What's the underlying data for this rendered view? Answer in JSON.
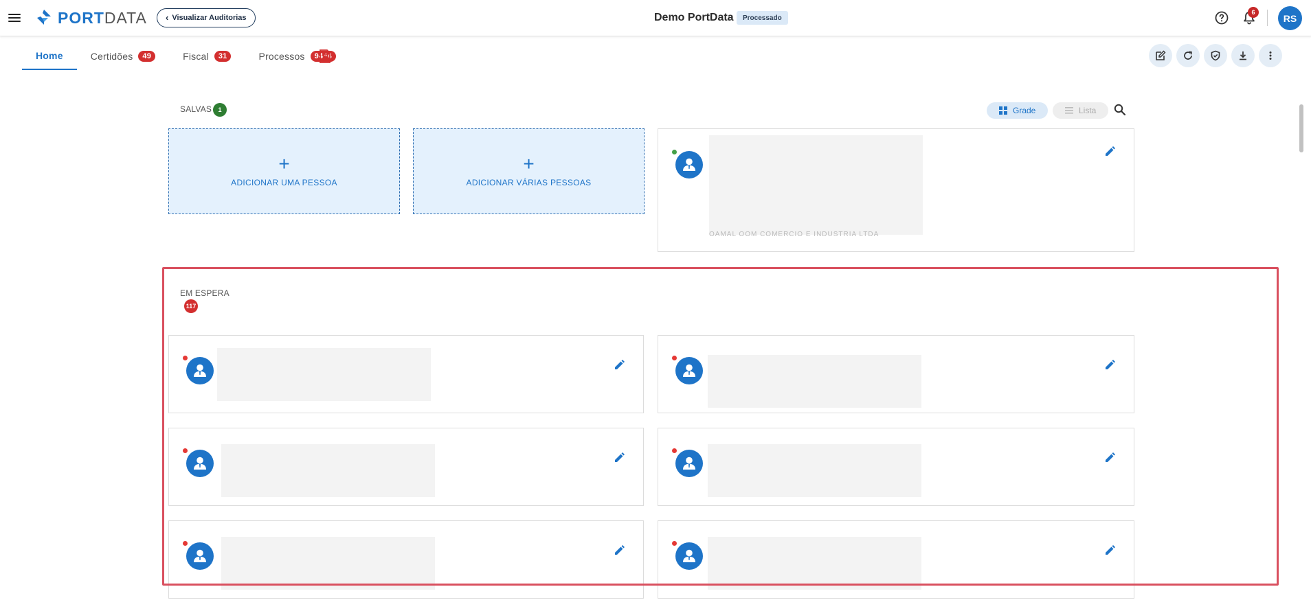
{
  "app": {
    "logo_text": "PORTDATA",
    "audit_button_label": "Visualizar Auditorias",
    "title": "Demo PortData",
    "status": "Processado",
    "notifications_count": "6",
    "user_initials": "RS"
  },
  "tabs": [
    {
      "label": "Home",
      "badge": null,
      "active": true
    },
    {
      "label": "Certidões",
      "badge": "49"
    },
    {
      "label": "Fiscal",
      "badge": "31"
    },
    {
      "label": "Processos",
      "badge": "9444"
    }
  ],
  "saved": {
    "label": "SALVAS",
    "count": "1",
    "count_color": "#2e7d32"
  },
  "view": {
    "grid_label": "Grade",
    "list_label": "Lista"
  },
  "add_cards": {
    "one": "ADICIONAR UMA PESSOA",
    "many": "ADICIONAR VÁRIAS PESSOAS"
  },
  "saved_card": {
    "status_color": "#43a047",
    "blurred_line": "OAMAL OOM COMERCIO E INDUSTRIA LTDA"
  },
  "waiting": {
    "label": "EM ESPERA",
    "count": "117",
    "count_color": "#d32f2f",
    "status_color": "#e53935"
  },
  "colors": {
    "accent": "#1e74c8",
    "highlight": "#d9505f",
    "danger_badge": "#d32f2f"
  }
}
